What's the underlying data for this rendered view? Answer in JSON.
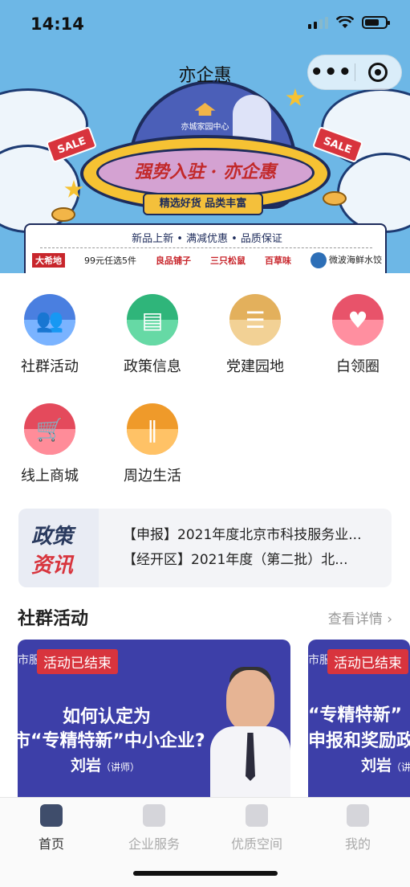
{
  "status": {
    "time": "14:14"
  },
  "header": {
    "title": "亦企惠"
  },
  "banner": {
    "slogan": "强势入驻 · 亦企惠",
    "subtitle": "精选好货  品类丰富",
    "features": "新品上新 • 满减优惠 • 品质保证",
    "sale": "SALE",
    "center_logo": "亦城家园中心",
    "brands": [
      "大希地",
      "99元任选5件",
      "良品铺子",
      "三只松鼠",
      "百草味",
      "微波海鲜水饺"
    ]
  },
  "grid": [
    {
      "label": "社群活动",
      "icon": "people-icon",
      "color": "#4a7fe0",
      "base": "#7ab3ff"
    },
    {
      "label": "政策信息",
      "icon": "building-icon",
      "color": "#2fb57a",
      "base": "#66d9a5"
    },
    {
      "label": "党建园地",
      "icon": "book-icon",
      "color": "#e3b05c",
      "base": "#f2d195"
    },
    {
      "label": "白领圈",
      "icon": "heart-icon",
      "color": "#e8536a",
      "base": "#ff8fa0"
    },
    {
      "label": "线上商城",
      "icon": "cart-icon",
      "color": "#e44a5c",
      "base": "#ff8c99"
    },
    {
      "label": "周边生活",
      "icon": "cutlery-icon",
      "color": "#ef9a2a",
      "base": "#ffc266"
    }
  ],
  "news": {
    "badge_line1": "政策",
    "badge_line2": "资讯",
    "items": [
      "【申报】2021年度北京市科技服务业...",
      "【经开区】2021年度（第二批）北..."
    ]
  },
  "section": {
    "title": "社群活动",
    "more": "查看详情 ›"
  },
  "cards": [
    {
      "status": "活动已结束",
      "org": "市服",
      "line1": "如何认定为",
      "line2": "市“专精特新”中小企业?",
      "speaker": "刘岩",
      "role": "（讲师）"
    },
    {
      "status": "活动已结束",
      "org": "市服",
      "line1": "“专精特新”",
      "line2": "申报和奖励政",
      "speaker": "刘岩",
      "role": "（讲"
    }
  ],
  "tabs": [
    {
      "label": "首页",
      "icon": "home-icon",
      "active": true
    },
    {
      "label": "企业服务",
      "icon": "briefcase-icon",
      "active": false
    },
    {
      "label": "优质空间",
      "icon": "building-icon",
      "active": false
    },
    {
      "label": "我的",
      "icon": "user-icon",
      "active": false
    }
  ],
  "colors": {
    "accent": "#d8343d",
    "sky": "#6db7e6",
    "card": "#3d3fa8"
  }
}
